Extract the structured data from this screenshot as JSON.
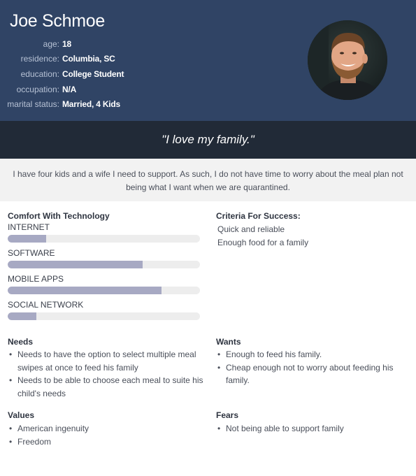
{
  "persona": {
    "name": "Joe Schmoe",
    "facts": [
      {
        "label": "age:",
        "value": "18"
      },
      {
        "label": "residence:",
        "value": "Columbia, SC"
      },
      {
        "label": "education:",
        "value": "College Student"
      },
      {
        "label": "occupation:",
        "value": "N/A"
      },
      {
        "label": "marital status:",
        "value": "Married, 4 Kids"
      }
    ],
    "avatar_icon": "person-photo-icon"
  },
  "quote": "\"I love my family.\"",
  "bio": "I have four kids and a wife I need to support. As such, I do not have time to worry about the meal plan not being what I want when we are quarantined.",
  "technology": {
    "title": "Comfort With Technology",
    "items": [
      {
        "label": "INTERNET",
        "level": 0.2
      },
      {
        "label": "SOFTWARE",
        "level": 0.7
      },
      {
        "label": "MOBILE APPS",
        "level": 0.8
      },
      {
        "label": "SOCIAL NETWORK",
        "level": 0.15
      }
    ]
  },
  "success": {
    "title": "Criteria For Success:",
    "items": [
      "Quick and reliable",
      "Enough food for a family"
    ]
  },
  "needs": {
    "title": "Needs",
    "items": [
      "Needs to have the option to select multiple meal swipes at once to feed his family",
      "Needs to be able to choose each meal to suite his child's needs"
    ]
  },
  "wants": {
    "title": "Wants",
    "items": [
      "Enough to feed his family.",
      "Cheap enough not to worry about feeding his family."
    ]
  },
  "values": {
    "title": "Values",
    "items": [
      "American ingenuity",
      "Freedom"
    ]
  },
  "fears": {
    "title": "Fears",
    "items": [
      "Not being able to support family"
    ]
  },
  "colors": {
    "header": "#304465",
    "quote_band": "#212a37",
    "bar_fill": "#a7a9c3",
    "bar_track": "#ededed"
  }
}
